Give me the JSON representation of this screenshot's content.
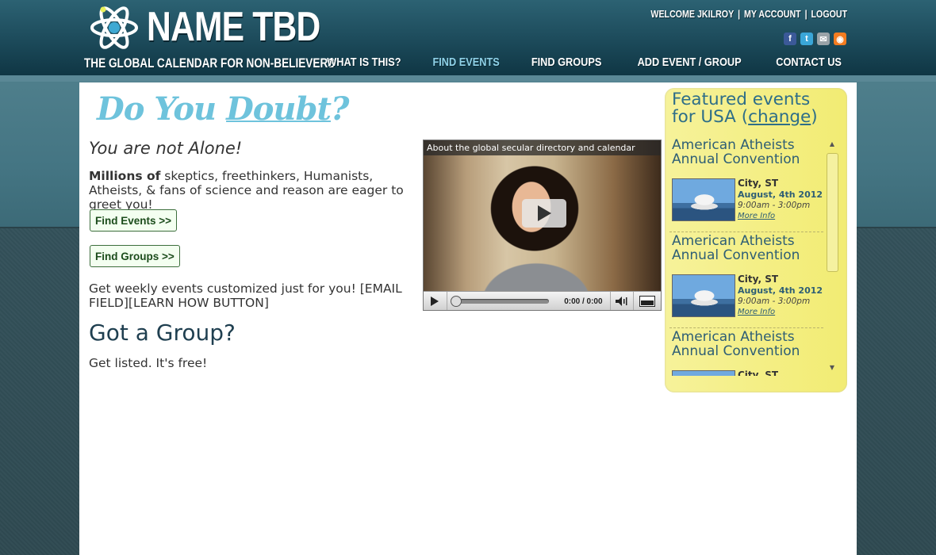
{
  "header": {
    "title": "NAME TBD",
    "tagline": "THE GLOBAL CALENDAR FOR NON-BELIEVERS",
    "user_links": [
      "WELCOME JKILROY",
      "MY ACCOUNT",
      "LOGOUT"
    ],
    "social": [
      {
        "name": "facebook-icon",
        "glyph": "f",
        "color": "#3b5998"
      },
      {
        "name": "twitter-icon",
        "glyph": "t",
        "color": "#3aa6d8"
      },
      {
        "name": "email-icon",
        "glyph": "✉",
        "color": "#9aa3a8"
      },
      {
        "name": "rss-icon",
        "glyph": "◉",
        "color": "#f47c20"
      }
    ],
    "nav": [
      {
        "label": "WHAT IS THIS?",
        "active": false
      },
      {
        "label": "FIND EVENTS",
        "active": true
      },
      {
        "label": "FIND GROUPS",
        "active": false
      },
      {
        "label": "ADD EVENT / GROUP",
        "active": false
      },
      {
        "label": "CONTACT US",
        "active": false
      }
    ]
  },
  "hero": {
    "title_part1": "Do You ",
    "title_part2": "Doubt",
    "title_part3": "?",
    "subtitle": "You are not Alone!",
    "millions_bold": "Millions of",
    "millions_text": " skeptics, freethinkers, Humanists, Atheists, & fans of science and reason are eager to greet you!",
    "find_events_button": "Find Events >>",
    "find_groups_button": "Find Groups >>",
    "weekly_text": "Get weekly events customized just for you! [EMAIL FIELD][LEARN HOW BUTTON]",
    "group_heading": "Got a Group?",
    "group_subtext": "Get listed. It's free!"
  },
  "video": {
    "caption": "About the global secular directory and calendar",
    "time": "0:00 / 0:00"
  },
  "sidebar": {
    "title_prefix": "Featured events for USA (",
    "change_link": "change",
    "title_suffix": ")",
    "events": [
      {
        "title": "American Atheists Annual Convention",
        "city": "City, ST",
        "date": "August, 4th 2012",
        "time": "9:00am - 3:00pm",
        "more": "More Info"
      },
      {
        "title": "American Atheists Annual Convention",
        "city": "City, ST",
        "date": "August, 4th 2012",
        "time": "9:00am - 3:00pm",
        "more": "More Info"
      },
      {
        "title": "American Atheists Annual Convention",
        "city": "City, ST",
        "date": "",
        "time": "",
        "more": ""
      }
    ]
  },
  "colors": {
    "accent": "#6ec3dc",
    "nav_active": "#8fd2e8",
    "sidebar_bg": "#f4ef85",
    "header_bg": "#1c4a5a"
  }
}
